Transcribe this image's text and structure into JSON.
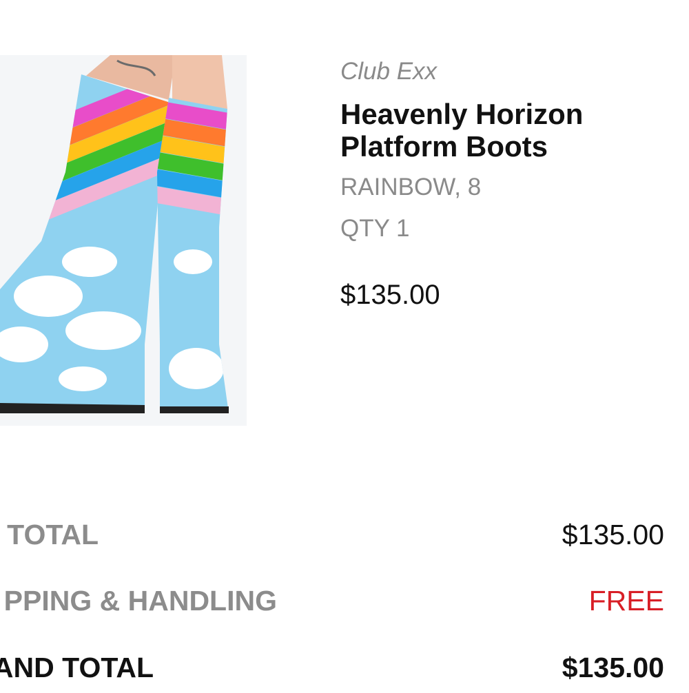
{
  "product": {
    "brand": "Club Exx",
    "title": "Heavenly Horizon Platform Boots",
    "variant": "RAINBOW, 8",
    "qty": "QTY 1",
    "price": "$135.00",
    "image_icon": "product-photo"
  },
  "summary": {
    "subtotal_label": "TOTAL",
    "subtotal_value": "$135.00",
    "shipping_label": "PPING & HANDLING",
    "shipping_value": "FREE",
    "grand_total_label": "AND TOTAL",
    "grand_total_value": "$135.00"
  },
  "colors": {
    "free_text": "#d81f26",
    "muted_text": "#8a8a8a",
    "boot_blue": "#8fd2f0"
  }
}
